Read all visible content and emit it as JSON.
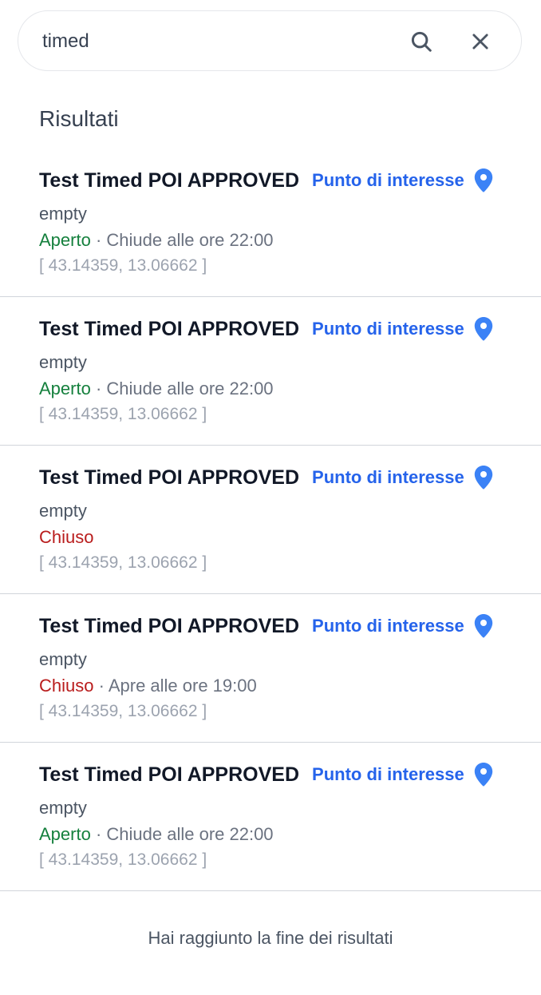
{
  "search": {
    "value": "timed",
    "search_icon": "search-icon",
    "clear_icon": "close-icon"
  },
  "section_title": "Risultati",
  "colors": {
    "accent": "#2563eb",
    "open": "#15803d",
    "closed": "#b91c1c",
    "pin": "#3b82f6"
  },
  "results": [
    {
      "name": "Test Timed POI APPROVED",
      "type": "Punto di interesse",
      "description": "empty",
      "status": "Aperto",
      "status_kind": "open",
      "separator": " · ",
      "hours": "Chiude alle ore 22:00",
      "coords": "[ 43.14359, 13.06662 ]"
    },
    {
      "name": "Test Timed POI APPROVED",
      "type": "Punto di interesse",
      "description": "empty",
      "status": "Aperto",
      "status_kind": "open",
      "separator": " · ",
      "hours": "Chiude alle ore 22:00",
      "coords": "[ 43.14359, 13.06662 ]"
    },
    {
      "name": "Test Timed POI APPROVED",
      "type": "Punto di interesse",
      "description": "empty",
      "status": "Chiuso",
      "status_kind": "closed",
      "separator": "",
      "hours": "",
      "coords": "[ 43.14359, 13.06662 ]"
    },
    {
      "name": "Test Timed POI APPROVED",
      "type": "Punto di interesse",
      "description": "empty",
      "status": "Chiuso",
      "status_kind": "closed",
      "separator": " · ",
      "hours": "Apre alle ore 19:00",
      "coords": "[ 43.14359, 13.06662 ]"
    },
    {
      "name": "Test Timed POI APPROVED",
      "type": "Punto di interesse",
      "description": "empty",
      "status": "Aperto",
      "status_kind": "open",
      "separator": " · ",
      "hours": "Chiude alle ore 22:00",
      "coords": "[ 43.14359, 13.06662 ]"
    }
  ],
  "end_message": "Hai raggiunto la fine dei risultati"
}
